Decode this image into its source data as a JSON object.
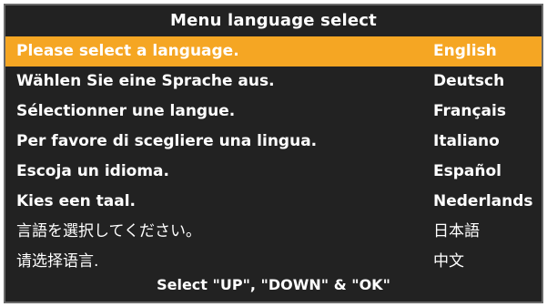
{
  "menu": {
    "title": "Menu language select",
    "footer": "Select \"UP\", \"DOWN\" & \"OK\"",
    "highlight_color": "#f5a623",
    "background_color": "#222222",
    "selected_index": 0,
    "languages": [
      {
        "prompt": "Please select a language.",
        "name": "English"
      },
      {
        "prompt": "Wählen Sie eine Sprache aus.",
        "name": "Deutsch"
      },
      {
        "prompt": "Sélectionner une langue.",
        "name": "Français"
      },
      {
        "prompt": "Per favore di scegliere una lingua.",
        "name": "Italiano"
      },
      {
        "prompt": "Escoja un idioma.",
        "name": "Español"
      },
      {
        "prompt": "Kies een taal.",
        "name": "Nederlands"
      },
      {
        "prompt": "言語を選択してください。",
        "name": "日本語"
      },
      {
        "prompt": "请选择语言.",
        "name": "中文"
      }
    ]
  }
}
